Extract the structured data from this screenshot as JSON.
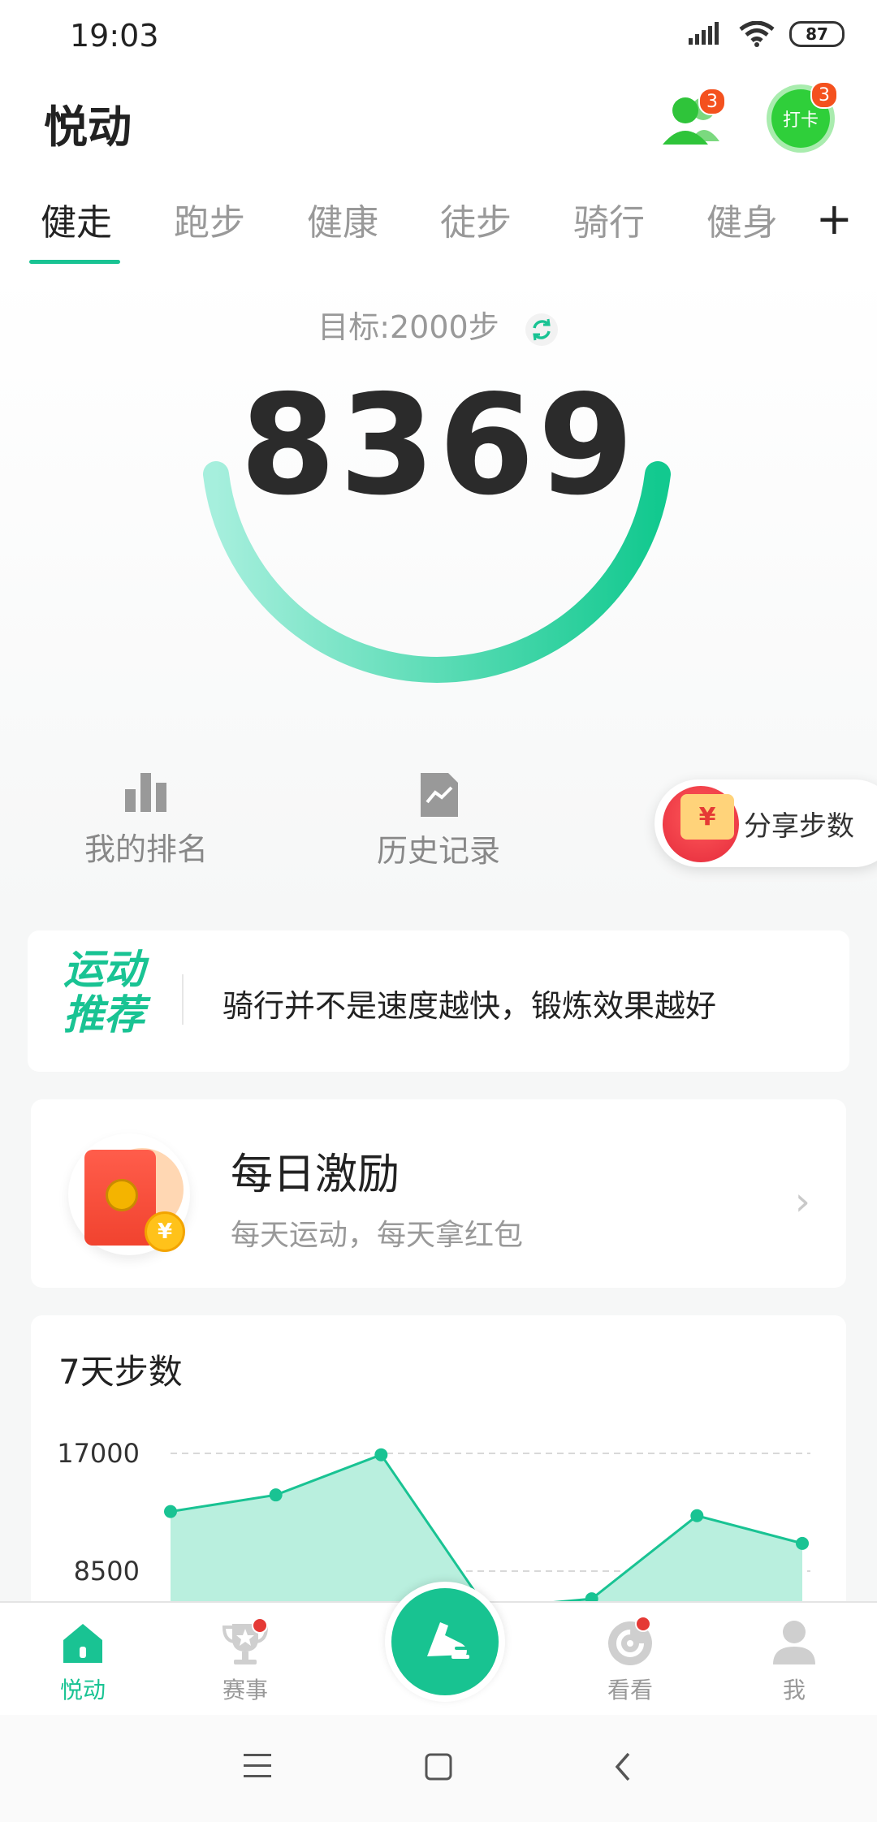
{
  "status_bar": {
    "time": "19:03",
    "battery": "87"
  },
  "header": {
    "title": "悦动",
    "friends_badge": "3",
    "checkin_label": "打卡",
    "checkin_badge": "3"
  },
  "tabs": {
    "items": [
      {
        "label": "健走",
        "active": true
      },
      {
        "label": "跑步",
        "active": false
      },
      {
        "label": "健康",
        "active": false
      },
      {
        "label": "徒步",
        "active": false
      },
      {
        "label": "骑行",
        "active": false
      },
      {
        "label": "健身",
        "active": false
      }
    ],
    "add_label": "+"
  },
  "hero": {
    "goal": "目标:2000步",
    "steps": "8369"
  },
  "actions": {
    "ranking": "我的排名",
    "history": "历史记录",
    "share": "分享步数",
    "share_symbol": "¥"
  },
  "recommend": {
    "logo_line1": "运动",
    "logo_line2": "推荐",
    "text": "骑行并不是速度越快，锻炼效果越好"
  },
  "daily_reward": {
    "title": "每日激励",
    "subtitle": "每天运动，每天拿红包",
    "coin_symbol": "¥"
  },
  "chart_data": {
    "type": "area",
    "title": "7天步数",
    "y_ticks": [
      "17000",
      "8500"
    ],
    "ylim": [
      0,
      17000
    ],
    "values": [
      12800,
      14000,
      16900,
      5800,
      6500,
      12500,
      10500
    ],
    "grid": true,
    "color": "#19c393"
  },
  "bottom_nav": {
    "items": [
      {
        "label": "悦动",
        "active": true
      },
      {
        "label": "赛事",
        "active": false
      },
      {
        "label": "看看",
        "active": false
      },
      {
        "label": "我",
        "active": false
      }
    ]
  },
  "colors": {
    "accent": "#19c393",
    "badge": "#f4511e"
  }
}
